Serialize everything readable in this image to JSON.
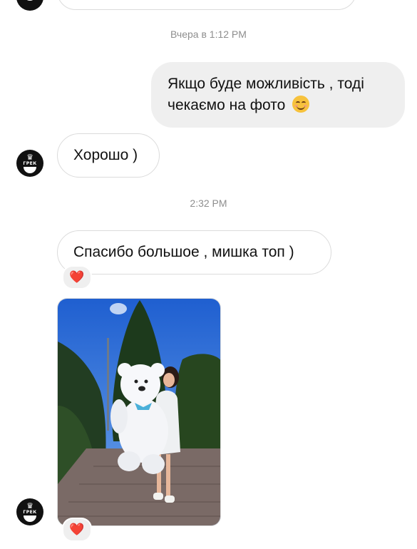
{
  "thread": {
    "timestamps": [
      "Вчера в 1:12 PM",
      "2:32 PM"
    ],
    "messages": [
      {
        "sender": "me",
        "text_line1": "Якщо буде можливість , тоді",
        "text_line2": "чекаємо на фото",
        "emoji": "smiling-face-emoji"
      },
      {
        "sender": "them",
        "text": "Хорошо )"
      },
      {
        "sender": "them",
        "text": "Спасибо большое , мишка топ )",
        "reaction": "❤️"
      },
      {
        "sender": "them",
        "type": "photo",
        "alt_icon": "photo-teddy-bear",
        "reaction": "❤️"
      }
    ]
  },
  "avatar": {
    "crown": "♛",
    "brand": "ГРЕК"
  },
  "colors": {
    "outgoing_bubble": "#efefef",
    "incoming_border": "#dbdbdb",
    "timestamp": "#8e8e8e",
    "heart": "#e0245e",
    "sky": "#2f6fd6"
  }
}
